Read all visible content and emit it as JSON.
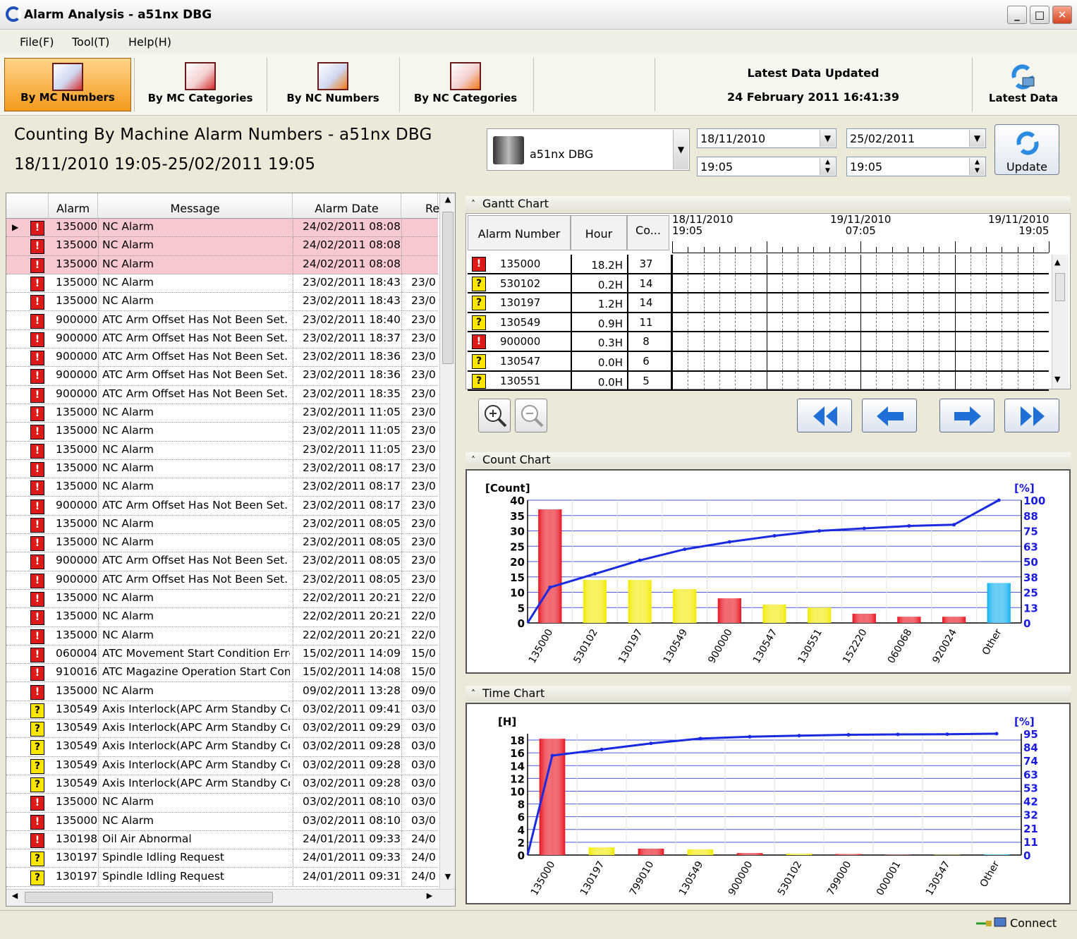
{
  "window": {
    "title": "Alarm Analysis - a51nx DBG",
    "min": "_",
    "max": "□",
    "close": "✕"
  },
  "menu": [
    "File(F)",
    "Tool(T)",
    "Help(H)"
  ],
  "toolbar": {
    "buttons": [
      "By MC Numbers",
      "By MC Categories",
      "By NC Numbers",
      "By NC Categories"
    ],
    "latest_label": "Latest Data Updated",
    "latest_date": "24 February 2011 16:41:39",
    "latest_button": "Latest Data"
  },
  "header": {
    "title": "Counting By Machine Alarm Numbers - a51nx DBG",
    "range": "18/11/2010 19:05-25/02/2011 19:05"
  },
  "filter": {
    "machine": "a51nx DBG",
    "from_date": "18/11/2010",
    "from_time": "19:05",
    "to_date": "25/02/2011",
    "to_time": "19:05",
    "update": "Update"
  },
  "grid": {
    "columns": [
      "Alarm",
      "Message",
      "Alarm Date",
      "Re"
    ],
    "rows": [
      [
        "r",
        "135000",
        "NC Alarm",
        "24/02/2011 08:08",
        "",
        1
      ],
      [
        "r",
        "135000",
        "NC Alarm",
        "24/02/2011 08:08",
        "",
        1
      ],
      [
        "r",
        "135000",
        "NC Alarm",
        "24/02/2011 08:08",
        "",
        1
      ],
      [
        "r",
        "135000",
        "NC Alarm",
        "23/02/2011 18:43",
        "23/0",
        0
      ],
      [
        "r",
        "135000",
        "NC Alarm",
        "23/02/2011 18:43",
        "23/0",
        0
      ],
      [
        "r",
        "900000",
        "ATC Arm Offset Has Not Been Set.",
        "23/02/2011 18:40",
        "23/0",
        0
      ],
      [
        "r",
        "900000",
        "ATC Arm Offset Has Not Been Set.",
        "23/02/2011 18:37",
        "23/0",
        0
      ],
      [
        "r",
        "900000",
        "ATC Arm Offset Has Not Been Set.",
        "23/02/2011 18:36",
        "23/0",
        0
      ],
      [
        "r",
        "900000",
        "ATC Arm Offset Has Not Been Set.",
        "23/02/2011 18:36",
        "23/0",
        0
      ],
      [
        "r",
        "900000",
        "ATC Arm Offset Has Not Been Set.",
        "23/02/2011 18:35",
        "23/0",
        0
      ],
      [
        "r",
        "135000",
        "NC Alarm",
        "23/02/2011 11:05",
        "23/0",
        0
      ],
      [
        "r",
        "135000",
        "NC Alarm",
        "23/02/2011 11:05",
        "23/0",
        0
      ],
      [
        "r",
        "135000",
        "NC Alarm",
        "23/02/2011 11:05",
        "23/0",
        0
      ],
      [
        "r",
        "135000",
        "NC Alarm",
        "23/02/2011 08:17",
        "23/0",
        0
      ],
      [
        "r",
        "135000",
        "NC Alarm",
        "23/02/2011 08:17",
        "23/0",
        0
      ],
      [
        "r",
        "900000",
        "ATC Arm Offset Has Not Been Set.",
        "23/02/2011 08:17",
        "23/0",
        0
      ],
      [
        "r",
        "135000",
        "NC Alarm",
        "23/02/2011 08:05",
        "23/0",
        0
      ],
      [
        "r",
        "135000",
        "NC Alarm",
        "23/02/2011 08:05",
        "23/0",
        0
      ],
      [
        "r",
        "900000",
        "ATC Arm Offset Has Not Been Set.",
        "23/02/2011 08:05",
        "23/0",
        0
      ],
      [
        "r",
        "900000",
        "ATC Arm Offset Has Not Been Set.",
        "23/02/2011 08:05",
        "23/0",
        0
      ],
      [
        "r",
        "135000",
        "NC Alarm",
        "22/02/2011 20:21",
        "22/0",
        0
      ],
      [
        "r",
        "135000",
        "NC Alarm",
        "22/02/2011 20:21",
        "22/0",
        0
      ],
      [
        "r",
        "135000",
        "NC Alarm",
        "22/02/2011 20:21",
        "22/0",
        0
      ],
      [
        "r",
        "060004",
        "ATC Movement Start Condition Error",
        "15/02/2011 14:09",
        "15/0",
        0
      ],
      [
        "r",
        "910016",
        "ATC Magazine Operation Start Condi",
        "15/02/2011 14:08",
        "15/0",
        0
      ],
      [
        "r",
        "135000",
        "NC Alarm",
        "09/02/2011 13:28",
        "09/0",
        0
      ],
      [
        "y",
        "130549",
        "Axis Interlock(APC Arm Standby Con",
        "03/02/2011 09:41",
        "03/0",
        0
      ],
      [
        "y",
        "130549",
        "Axis Interlock(APC Arm Standby Con",
        "03/02/2011 09:29",
        "03/0",
        0
      ],
      [
        "y",
        "130549",
        "Axis Interlock(APC Arm Standby Con",
        "03/02/2011 09:28",
        "03/0",
        0
      ],
      [
        "y",
        "130549",
        "Axis Interlock(APC Arm Standby Con",
        "03/02/2011 09:28",
        "03/0",
        0
      ],
      [
        "y",
        "130549",
        "Axis Interlock(APC Arm Standby Con",
        "03/02/2011 09:28",
        "03/0",
        0
      ],
      [
        "r",
        "135000",
        "NC Alarm",
        "03/02/2011 08:10",
        "03/0",
        0
      ],
      [
        "r",
        "135000",
        "NC Alarm",
        "03/02/2011 08:10",
        "03/0",
        0
      ],
      [
        "r",
        "130198",
        "Oil Air Abnormal",
        "24/01/2011 09:33",
        "24/0",
        0
      ],
      [
        "y",
        "130197",
        "Spindle Idling Request",
        "24/01/2011 09:33",
        "24/0",
        0
      ],
      [
        "y",
        "130197",
        "Spindle Idling Request",
        "24/01/2011 09:31",
        "24/0",
        0
      ]
    ]
  },
  "gantt": {
    "title": "Gantt Chart",
    "columns": [
      "Alarm Number",
      "Hour",
      "Co..."
    ],
    "time_labels": [
      [
        "18/11/2010",
        "19:05"
      ],
      [
        "19/11/2010",
        "07:05"
      ],
      [
        "19/11/2010",
        "19:05"
      ]
    ],
    "rows": [
      [
        "r",
        "135000",
        "18.2H",
        "37"
      ],
      [
        "y",
        "530102",
        "0.2H",
        "14"
      ],
      [
        "y",
        "130197",
        "1.2H",
        "14"
      ],
      [
        "y",
        "130549",
        "0.9H",
        "11"
      ],
      [
        "r",
        "900000",
        "0.3H",
        "8"
      ],
      [
        "y",
        "130547",
        "0.0H",
        "6"
      ],
      [
        "y",
        "130551",
        "0.0H",
        "5"
      ]
    ]
  },
  "count_chart": {
    "title": "Count Chart"
  },
  "time_chart": {
    "title": "Time Chart"
  },
  "status": {
    "connect": "Connect"
  },
  "chart_data": [
    {
      "type": "bar",
      "title": "Count Chart",
      "ylabel": "[Count]",
      "y2label": "[%]",
      "ylim": [
        0,
        40
      ],
      "y2lim": [
        0,
        100
      ],
      "yticks": [
        0,
        5,
        10,
        15,
        20,
        25,
        30,
        35,
        40
      ],
      "y2ticks": [
        0,
        13,
        25,
        38,
        50,
        63,
        75,
        88,
        100
      ],
      "categories": [
        "135000",
        "530102",
        "130197",
        "130549",
        "900000",
        "130547",
        "130551",
        "152220",
        "060068",
        "920024",
        "Other"
      ],
      "values": [
        37,
        14,
        14,
        11,
        8,
        6,
        5,
        3,
        2,
        2,
        13
      ],
      "colors": [
        "#e8131f",
        "#f2ea00",
        "#f2ea00",
        "#f2ea00",
        "#e8131f",
        "#f2ea00",
        "#f2ea00",
        "#e8131f",
        "#e8131f",
        "#e8131f",
        "#12b0f0"
      ],
      "cumulative_pct": [
        29,
        40,
        51,
        60,
        66,
        71,
        75,
        77,
        79,
        80,
        100
      ]
    },
    {
      "type": "bar",
      "title": "Time Chart",
      "ylabel": "[H]",
      "y2label": "[%]",
      "ylim": [
        0,
        19
      ],
      "y2lim": [
        0,
        100
      ],
      "yticks": [
        0,
        2,
        4,
        6,
        8,
        10,
        12,
        14,
        16,
        18
      ],
      "y2ticks": [
        0,
        11,
        21,
        32,
        42,
        53,
        63,
        74,
        84,
        95
      ],
      "categories": [
        "135000",
        "130197",
        "799010",
        "130549",
        "900000",
        "530102",
        "799000",
        "000001",
        "130547",
        "Other"
      ],
      "values": [
        18.2,
        1.2,
        1.0,
        0.9,
        0.3,
        0.2,
        0.15,
        0.05,
        0.03,
        0.1
      ],
      "colors": [
        "#e8131f",
        "#f2ea00",
        "#e8131f",
        "#f2ea00",
        "#e8131f",
        "#f2ea00",
        "#e8131f",
        "#e8131f",
        "#f2ea00",
        "#12b0f0"
      ],
      "cumulative_pct": [
        82,
        87,
        92,
        96,
        97.5,
        98.4,
        99.1,
        99.4,
        99.6,
        100
      ]
    }
  ]
}
